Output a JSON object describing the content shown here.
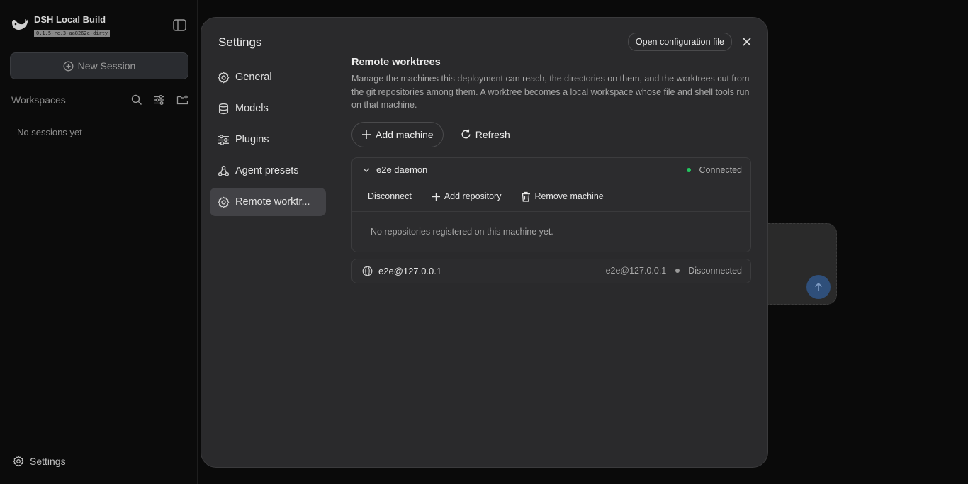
{
  "sidebar": {
    "brand_title": "DSH Local Build",
    "brand_version": "0.1.5-rc.3-aa8262e-dirty",
    "new_session_label": "New Session",
    "workspaces_label": "Workspaces",
    "empty_label": "No sessions yet",
    "settings_label": "Settings"
  },
  "modal": {
    "title": "Settings",
    "open_config_label": "Open configuration file",
    "nav": [
      {
        "label": "General",
        "icon": "gear-icon"
      },
      {
        "label": "Models",
        "icon": "database-icon"
      },
      {
        "label": "Plugins",
        "icon": "sliders-icon"
      },
      {
        "label": "Agent presets",
        "icon": "agent-icon"
      },
      {
        "label": "Remote worktr...",
        "icon": "gear-icon",
        "active": true
      }
    ]
  },
  "remote": {
    "title": "Remote worktrees",
    "description": "Manage the machines this deployment can reach, the directories on them, and the worktrees cut from the git repositories among them. A worktree becomes a local workspace whose file and shell tools run on that machine.",
    "add_machine_label": "Add machine",
    "refresh_label": "Refresh",
    "machines": [
      {
        "name": "e2e daemon",
        "status": "Connected",
        "status_color": "#22c55e",
        "actions": {
          "disconnect": "Disconnect",
          "add_repo": "Add repository",
          "remove": "Remove machine"
        },
        "empty": "No repositories registered on this machine yet."
      },
      {
        "name": "e2e@127.0.0.1",
        "host": "e2e@127.0.0.1",
        "status": "Disconnected",
        "status_color": "#9a9a9a"
      }
    ]
  }
}
